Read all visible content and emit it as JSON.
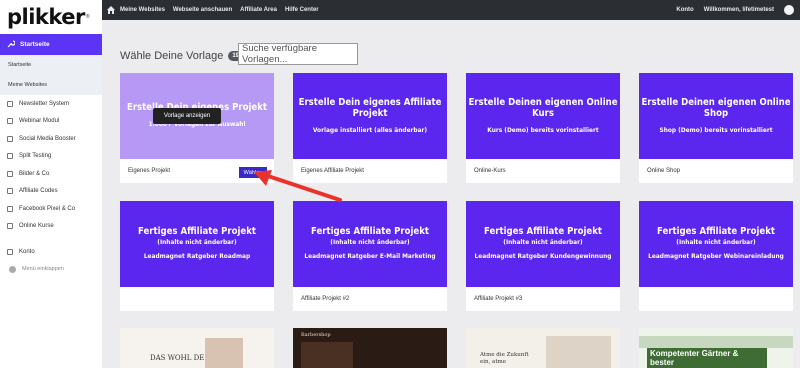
{
  "brand": {
    "name": "plikker",
    "reg": "®"
  },
  "topbar": {
    "links": [
      "Meine Websites",
      "Webseite anschauen",
      "Affiliate Area",
      "Hilfe Center"
    ],
    "account": "Konto",
    "welcome": "Willkommen, lifetimetest"
  },
  "sidebar": {
    "active": "Startseite",
    "sub": [
      "Startseite",
      "Meine Websites"
    ],
    "items": [
      "Newsletter System",
      "Webinar Modul",
      "Social Media Booster",
      "Split Testing",
      "Bilder & Co",
      "Affiliate Codes",
      "Facebook Pixel & Co",
      "Online Kurse"
    ],
    "konto": "Konto",
    "collapse": "Menü einklappen"
  },
  "main": {
    "heading": "Wähle Deine Vorlage",
    "count": "19",
    "search_placeholder": "Suche verfügbare Vorlagen..."
  },
  "cards": [
    {
      "title": "Erstelle Dein eigenes Projekt",
      "sub": "1.000+ Vorlagen zur Auswahl",
      "caption": "Eigenes Projekt",
      "overlay": "Vorlage anzeigen",
      "choose": "Wählen"
    },
    {
      "title": "Erstelle Dein eigenes Affiliate Projekt",
      "sub": "Vorlage installiert (alles änderbar)",
      "caption": "Eigenes Affiliate Projekt"
    },
    {
      "title": "Erstelle Deinen eigenen Online Kurs",
      "sub": "Kurs (Demo) bereits vorinstalliert",
      "caption": "Online-Kurs"
    },
    {
      "title": "Erstelle Deinen eigenen Online Shop",
      "sub": "Shop (Demo) bereits vorinstalliert",
      "caption": "Online Shop"
    },
    {
      "title": "Fertiges Affiliate Projekt",
      "subtitle": "(Inhalte nicht änderbar)",
      "sub": "Leadmagnet Ratgeber Roadmap",
      "caption": ""
    },
    {
      "title": "Fertiges Affiliate Projekt",
      "subtitle": "(Inhalte nicht änderbar)",
      "sub": "Leadmagnet Ratgeber E-Mail Marketing",
      "caption": "Affiliate Projekt #2"
    },
    {
      "title": "Fertiges Affiliate Projekt",
      "subtitle": "(Inhalte nicht änderbar)",
      "sub": "Leadmagnet Ratgeber Kundengewinnung",
      "caption": "Affiliate Projekt #3"
    },
    {
      "title": "Fertiges Affiliate Projekt",
      "subtitle": "(Inhalte nicht änderbar)",
      "sub": "Leadmagnet Ratgeber Webinareinladung",
      "caption": ""
    }
  ],
  "previews": {
    "p1": "DAS WOHL DES",
    "p2": "Barbershop",
    "p3": "Atme die Zukunft ein, atme",
    "p4": "Kompetenter Gärtner & bester"
  },
  "colors": {
    "accent": "#5b34f5",
    "card": "#5b26ee",
    "arrow": "#e8322c"
  }
}
